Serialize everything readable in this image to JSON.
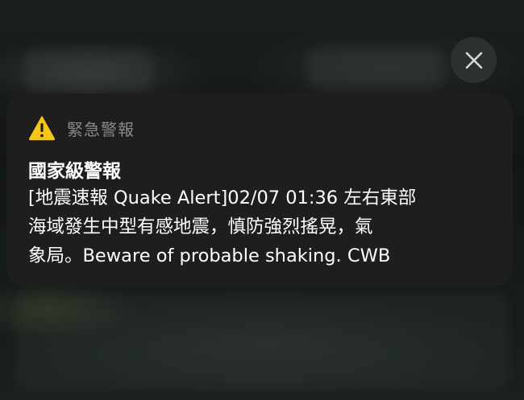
{
  "close_button": {
    "icon": "close-icon"
  },
  "alert": {
    "app_icon": "warning-icon",
    "app_name": "緊急警報",
    "title": "國家級警報",
    "body_lines": [
      "[地震速報 Quake Alert]02/07 01:36 左右東部",
      "海域發生中型有感地震，慎防強烈搖晃，氣",
      "象局。Beware of probable shaking. CWB"
    ]
  },
  "colors": {
    "card_background": "#1e1e1e",
    "warning_yellow": "#f5c518",
    "secondary_text": "#8a8a8e",
    "primary_text": "#ffffff"
  }
}
